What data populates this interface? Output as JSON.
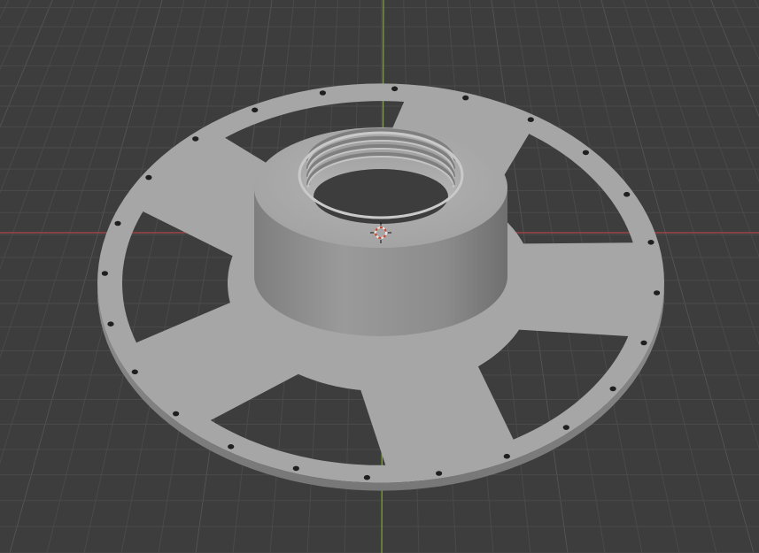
{
  "viewport": {
    "name": "3d-viewport",
    "background": "#3d3d3d",
    "grid_minor": "#4a4a4a",
    "grid_major": "#525252",
    "x_axis_color": "#b0464a",
    "y_axis_color": "#84a33a",
    "mesh_color": "#a6a6a6"
  },
  "scene": {
    "object": "spool-flange",
    "ring_holes": 24,
    "spokes": 5,
    "thread_grooves": 4,
    "origin_icon": "3d-cursor-icon"
  }
}
